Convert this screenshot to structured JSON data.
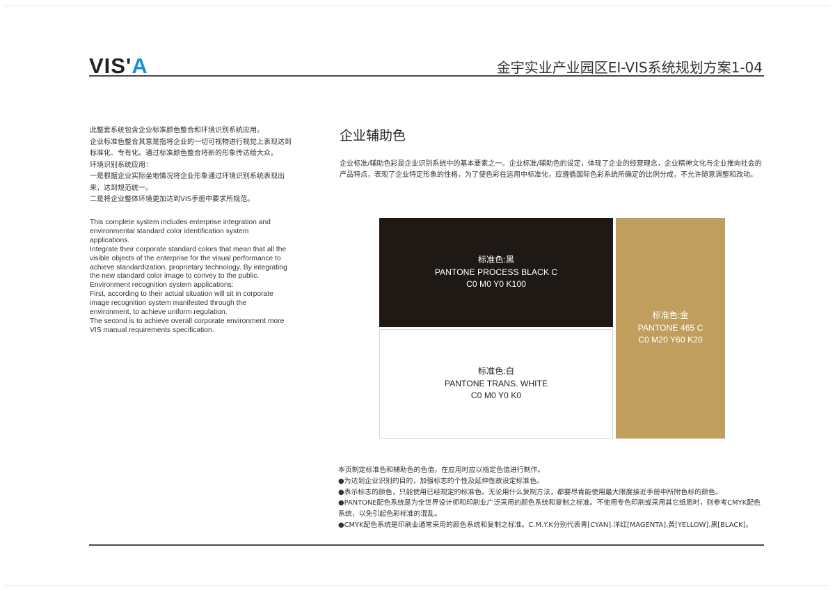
{
  "header": {
    "logo_main": "VIS'",
    "logo_accent": "A",
    "title": "金宇实业产业园区EI-VIS系统规划方案1-04"
  },
  "intro_cn": [
    "此整套系统包含企业标准颜色整合和环境识别系统应用。",
    "企业标准色整合其意是指将企业的一切可视物进行视觉上表现达到",
    "标准化、专有化。通过标准颜色整合将新的形象传达给大众。",
    "环境识别系统应用：",
    "一是根据企业实际坐地情况将企业形象通过环境识别系统表现出",
    "来，达到规范统一。",
    "二是将企业整体环境更加达到VIS手册中要求所规范。"
  ],
  "intro_en": [
    "This complete system includes enterprise integration and",
    "environmental standard color identification system",
    "applications.",
    "Integrate their corporate standard colors that mean that all the",
    "visible objects of the enterprise for the visual performance to",
    "achieve standardization, proprietary technology. By integrating",
    "the new standard color image to convey to the public.",
    "Environment recognition system applications:",
    "First, according to their actual situation will sit in corporate",
    "image recognition system manifested through the",
    "environment, to achieve uniform regulation.",
    "The second is to achieve overall corporate environment more",
    "VIS manual requirements specification."
  ],
  "section": {
    "title": "企业辅助色",
    "description": "企业标准/辅助色彩是企业识别系统中的基本要素之一。企业标准/辅助色的设定，体现了企业的经营理念，企业精神文化与企业推向社会的产品特点，表现了企业特定形象的性格，为了使色彩在运用中标准化，应遵循国际色彩系统所确定的比例分成，不允许随意调整和改动。"
  },
  "swatches": {
    "black": {
      "label": "标准色:黑",
      "pantone": "PANTONE PROCESS BLACK C",
      "cmyk": "C0 M0 Y0 K100",
      "color": "#1f1915"
    },
    "white": {
      "label": "标准色:白",
      "pantone": "PANTONE TRANS. WHITE",
      "cmyk": "C0 M0 Y0 K0",
      "color": "#ffffff"
    },
    "gold": {
      "label": "标准色:金",
      "pantone": "PANTONE 465 C",
      "cmyk": "C0 M20 Y60 K20",
      "color": "#bf9e5e"
    }
  },
  "notes": [
    "本页制定标准色和辅助色的色值，在应用时应以指定色值进行制作。",
    "●为达到企业识别的目的，加强标志的个性及延伸性故设定标准色。",
    "●表示标志的颜色，只能使用已经规定的标准色。无论用什么复制方法，都要尽肯能使用最大限度接近手册中所附色标的颜色。",
    "●PANTONE配色系统是为全世界设计师和印刷业广泛采用的颜色系统和复制之标准。不使用专色印刷或采用其它纸质时，则参考CMYK配色系统，以免引起色彩标准的混乱。",
    "●CMYK配色系统是印刷业通常采用的颜色系统和复制之标准。C.M.Y.K分别代表青[CYAN].洋红[MAGENTA].黄[YELLOW].黑[BLACK]。"
  ]
}
